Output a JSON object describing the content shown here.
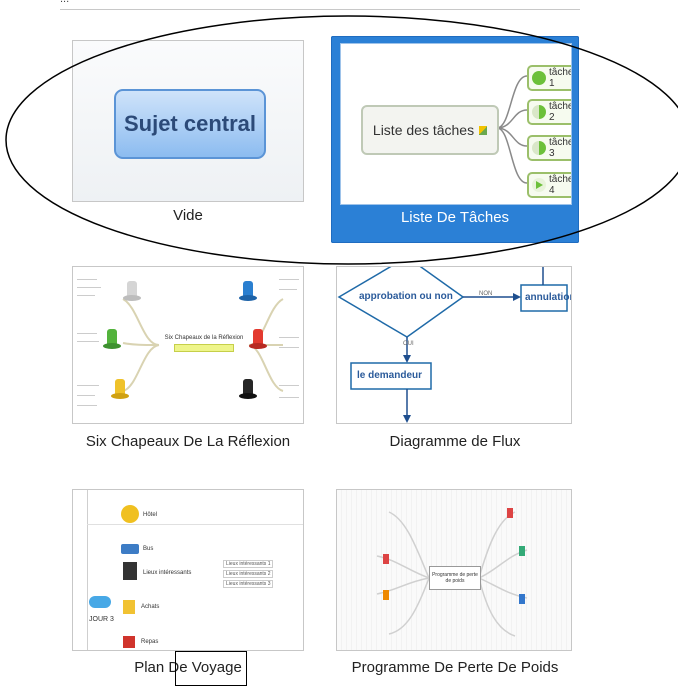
{
  "header": {
    "title": "..."
  },
  "templates": [
    {
      "caption": "Vide",
      "central_topic": "Sujet central"
    },
    {
      "caption": "Liste De Tâches",
      "root": "Liste des tâches",
      "tasks": [
        "tâche 1",
        "tâche 2",
        "tâche 3",
        "tâche 4"
      ]
    },
    {
      "caption": "Six Chapeaux De La Réflexion",
      "center": "Six Chapeaux de la Réflexion"
    },
    {
      "caption": "Diagramme de Flux",
      "decision": "approbation ou non",
      "branch_no": "NON",
      "branch_yes": "OUI",
      "target_no": "annulation",
      "target_yes": "le demandeur"
    },
    {
      "caption": "Plan De Voyage",
      "day": "JOUR 3",
      "rows": [
        "Hôtel",
        "Bus",
        "Lieux intéressants",
        "Achats",
        "Repas"
      ],
      "places": [
        "Lieux intéressants 1",
        "Lieux intéressants 2",
        "Lieux intéressants 3"
      ]
    },
    {
      "caption": "Programme De Perte De Poids",
      "center": "Programme de perte de poids"
    }
  ],
  "colors": {
    "selection": "#2b80d6",
    "accent_task": "#8cc63f",
    "flow": "#1f4f8f"
  }
}
